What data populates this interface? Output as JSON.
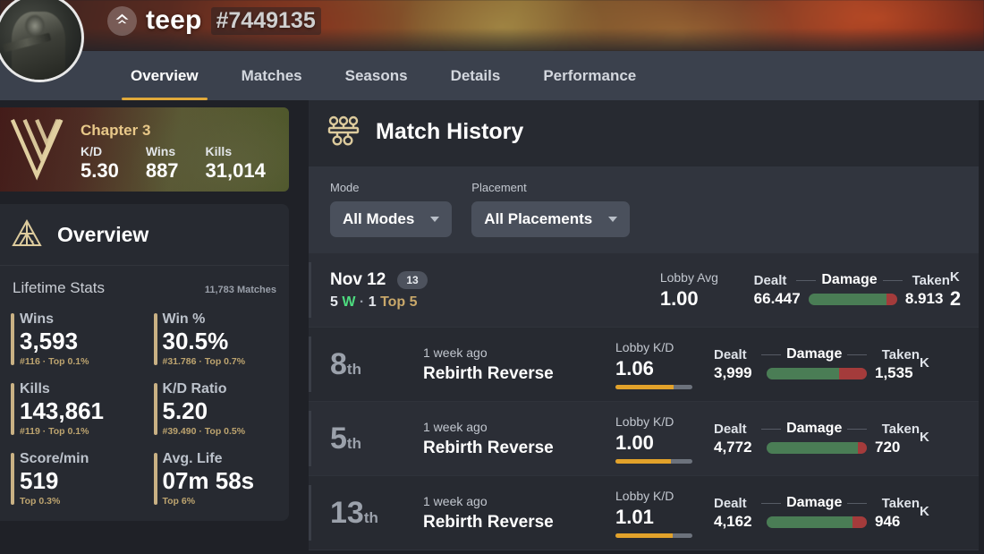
{
  "banner": {
    "player_name": "teep",
    "player_tag": "#7449135",
    "platform_icon": "activision-icon",
    "avatar_icon": "player-avatar"
  },
  "nav": {
    "tabs": [
      {
        "label": "Overview",
        "active": true
      },
      {
        "label": "Matches",
        "active": false
      },
      {
        "label": "Seasons",
        "active": false
      },
      {
        "label": "Details",
        "active": false
      },
      {
        "label": "Performance",
        "active": false
      }
    ]
  },
  "sidebar": {
    "chapter": {
      "title": "Chapter 3",
      "logo_icon": "chapter-v-logo",
      "stats": [
        {
          "label": "K/D",
          "value": "5.30"
        },
        {
          "label": "Wins",
          "value": "887"
        },
        {
          "label": "Kills",
          "value": "31,014"
        }
      ]
    },
    "overview": {
      "icon": "pyramid-icon",
      "title": "Overview",
      "lifetime_label": "Lifetime Stats",
      "matches_count": "11,783 Matches",
      "stats": [
        {
          "label": "Wins",
          "value": "3,593",
          "sub": "#116 · Top 0.1%"
        },
        {
          "label": "Win %",
          "value": "30.5%",
          "sub": "#31.786 · Top 0.7%"
        },
        {
          "label": "Kills",
          "value": "143,861",
          "sub": "#119 · Top 0.1%"
        },
        {
          "label": "K/D Ratio",
          "value": "5.20",
          "sub": "#39.490 · Top 0.5%"
        },
        {
          "label": "Score/min",
          "value": "519",
          "sub": "Top 0.3%"
        },
        {
          "label": "Avg. Life",
          "value": "07m 58s",
          "sub": "Top 6%"
        }
      ]
    }
  },
  "main": {
    "header": {
      "icon": "match-history-icon",
      "title": "Match History"
    },
    "filters": [
      {
        "label": "Mode",
        "value": "All Modes",
        "name": "mode-filter"
      },
      {
        "label": "Placement",
        "value": "All Placements",
        "name": "placement-filter"
      }
    ],
    "date_summary": {
      "date": "Nov 12",
      "count_badge": "13",
      "wins": "5",
      "wins_suffix": "W",
      "separator": "·",
      "top5_count": "1",
      "top5_label": "Top 5",
      "lobby_label": "Lobby Avg",
      "lobby_value": "1.00",
      "dealt_label": "Dealt",
      "dealt_value": "66.447",
      "damage_label": "Damage",
      "taken_label": "Taken",
      "taken_value": "8.913",
      "damage_green_pct": 88,
      "damage_red_pct": 12,
      "kills_label": "K",
      "kills_value": "2"
    },
    "matches": [
      {
        "place_num": "8",
        "place_suffix": "th",
        "ago": "1 week ago",
        "mode": "Rebirth Reverse",
        "lobby_label": "Lobby K/D",
        "lobby_value": "1.06",
        "lobby_bar_pct": 76,
        "dealt_label": "Dealt",
        "dealt_value": "3,999",
        "damage_label": "Damage",
        "taken_label": "Taken",
        "taken_value": "1,535",
        "damage_green_pct": 72,
        "damage_red_pct": 28,
        "kills_label": "K"
      },
      {
        "place_num": "5",
        "place_suffix": "th",
        "ago": "1 week ago",
        "mode": "Rebirth Reverse",
        "lobby_label": "Lobby K/D",
        "lobby_value": "1.00",
        "lobby_bar_pct": 72,
        "dealt_label": "Dealt",
        "dealt_value": "4,772",
        "damage_label": "Damage",
        "taken_label": "Taken",
        "taken_value": "720",
        "damage_green_pct": 91,
        "damage_red_pct": 9,
        "kills_label": "K"
      },
      {
        "place_num": "13",
        "place_suffix": "th",
        "ago": "1 week ago",
        "mode": "Rebirth Reverse",
        "lobby_label": "Lobby K/D",
        "lobby_value": "1.01",
        "lobby_bar_pct": 74,
        "dealt_label": "Dealt",
        "dealt_value": "4,162",
        "damage_label": "Damage",
        "taken_label": "Taken",
        "taken_value": "946",
        "damage_green_pct": 86,
        "damage_red_pct": 14,
        "kills_label": "K"
      }
    ]
  },
  "colors": {
    "accent_gold": "#e0a93a",
    "win_green": "#4ddb7f",
    "bar_green": "#4a7d55",
    "bar_red": "#a43b3b",
    "panel": "#272a31",
    "panel_alt": "#2b2e36"
  }
}
